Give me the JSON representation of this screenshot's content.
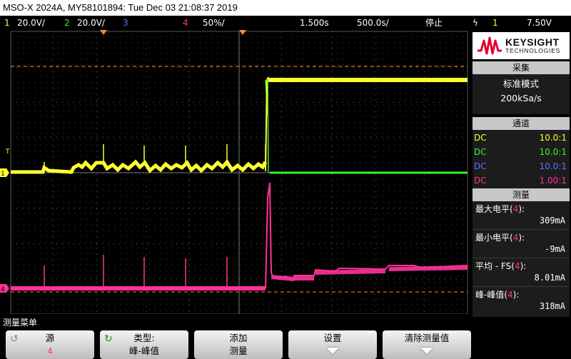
{
  "title": "MSO-X 2024A, MY58101894: Tue Dec 03 21:08:37 2019",
  "status": {
    "ch1_num": "1",
    "ch1_scale": "20.0V/",
    "ch2_num": "2",
    "ch2_scale": "20.0V/",
    "ch3_num": "3",
    "ch4_num": "4",
    "ch4_scale": "50%/",
    "delay": "1.500s",
    "timebase": "500.0s/",
    "run_state": "停止",
    "trig_icon": "ϟ",
    "trig_src": "1",
    "trig_level": "7.50V"
  },
  "logo": {
    "brand": "KEYSIGHT",
    "sub": "TECHNOLOGIES"
  },
  "acquisition": {
    "header": "采集",
    "mode": "标准模式",
    "rate": "200kSa/s"
  },
  "channels": {
    "header": "通道",
    "rows": [
      {
        "coupling": "DC",
        "probe": "10.0:1",
        "color": "#ffff33"
      },
      {
        "coupling": "DC",
        "probe": "10.0:1",
        "color": "#44ee33"
      },
      {
        "coupling": "DC",
        "probe": "10.0:1",
        "color": "#5577ff"
      },
      {
        "coupling": "DC",
        "probe": "1.00:1",
        "color": "#ff3399"
      }
    ]
  },
  "measurements": {
    "header": "测量",
    "items": [
      {
        "name": "最大电平",
        "src": "4",
        "value": "309mA"
      },
      {
        "name": "最小电平",
        "src": "4",
        "value": "-9mA"
      },
      {
        "name": "平均 - FS",
        "src": "4",
        "value": "8.01mA"
      },
      {
        "name": "峰-峰值",
        "src": "4",
        "value": "318mA"
      }
    ]
  },
  "menu": {
    "title": "测量菜单",
    "softkeys": [
      {
        "line1": "源",
        "line2": "4"
      },
      {
        "line1": "类型:",
        "line2": "峰-峰值"
      },
      {
        "line1": "添加",
        "line2": "测量"
      },
      {
        "line1": "设置",
        "line2": ""
      },
      {
        "line1": "清除测量值",
        "line2": ""
      }
    ]
  },
  "markers": {
    "trigger_level_label": "T",
    "ch1_ground": "1",
    "ch4_ground": "4"
  },
  "trace_colors": {
    "ch1": "#ffff33",
    "ch2": "#44ee33",
    "ch3": "#5577ff",
    "ch4": "#ff3399"
  }
}
